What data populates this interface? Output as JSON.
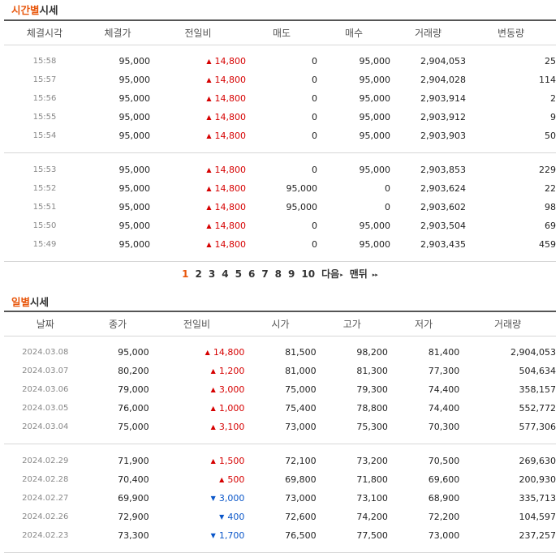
{
  "time_section": {
    "title_hl": "시간별",
    "title_rest": "시세",
    "headers": [
      "체결시각",
      "체결가",
      "전일비",
      "매도",
      "매수",
      "거래량",
      "변동량"
    ],
    "groups": [
      [
        {
          "time": "15:58",
          "price": "95,000",
          "dir": "up",
          "diff": "14,800",
          "sell": "0",
          "buy": "95,000",
          "volume": "2,904,053",
          "change": "25"
        },
        {
          "time": "15:57",
          "price": "95,000",
          "dir": "up",
          "diff": "14,800",
          "sell": "0",
          "buy": "95,000",
          "volume": "2,904,028",
          "change": "114"
        },
        {
          "time": "15:56",
          "price": "95,000",
          "dir": "up",
          "diff": "14,800",
          "sell": "0",
          "buy": "95,000",
          "volume": "2,903,914",
          "change": "2"
        },
        {
          "time": "15:55",
          "price": "95,000",
          "dir": "up",
          "diff": "14,800",
          "sell": "0",
          "buy": "95,000",
          "volume": "2,903,912",
          "change": "9"
        },
        {
          "time": "15:54",
          "price": "95,000",
          "dir": "up",
          "diff": "14,800",
          "sell": "0",
          "buy": "95,000",
          "volume": "2,903,903",
          "change": "50"
        }
      ],
      [
        {
          "time": "15:53",
          "price": "95,000",
          "dir": "up",
          "diff": "14,800",
          "sell": "0",
          "buy": "95,000",
          "volume": "2,903,853",
          "change": "229"
        },
        {
          "time": "15:52",
          "price": "95,000",
          "dir": "up",
          "diff": "14,800",
          "sell": "95,000",
          "buy": "0",
          "volume": "2,903,624",
          "change": "22"
        },
        {
          "time": "15:51",
          "price": "95,000",
          "dir": "up",
          "diff": "14,800",
          "sell": "95,000",
          "buy": "0",
          "volume": "2,903,602",
          "change": "98"
        },
        {
          "time": "15:50",
          "price": "95,000",
          "dir": "up",
          "diff": "14,800",
          "sell": "0",
          "buy": "95,000",
          "volume": "2,903,504",
          "change": "69"
        },
        {
          "time": "15:49",
          "price": "95,000",
          "dir": "up",
          "diff": "14,800",
          "sell": "0",
          "buy": "95,000",
          "volume": "2,903,435",
          "change": "459"
        }
      ]
    ]
  },
  "pagination": {
    "pages": [
      "1",
      "2",
      "3",
      "4",
      "5",
      "6",
      "7",
      "8",
      "9",
      "10"
    ],
    "current": "1",
    "next_label": "다음",
    "next_icon": "▸",
    "last_label": "맨뒤",
    "last_icon": "▸▸"
  },
  "daily_section": {
    "title_hl": "일별",
    "title_rest": "시세",
    "headers": [
      "날짜",
      "종가",
      "전일비",
      "시가",
      "고가",
      "저가",
      "거래량"
    ],
    "groups": [
      [
        {
          "date": "2024.03.08",
          "close": "95,000",
          "dir": "up",
          "diff": "14,800",
          "open": "81,500",
          "high": "98,200",
          "low": "81,400",
          "volume": "2,904,053"
        },
        {
          "date": "2024.03.07",
          "close": "80,200",
          "dir": "up",
          "diff": "1,200",
          "open": "81,000",
          "high": "81,300",
          "low": "77,300",
          "volume": "504,634"
        },
        {
          "date": "2024.03.06",
          "close": "79,000",
          "dir": "up",
          "diff": "3,000",
          "open": "75,000",
          "high": "79,300",
          "low": "74,400",
          "volume": "358,157"
        },
        {
          "date": "2024.03.05",
          "close": "76,000",
          "dir": "up",
          "diff": "1,000",
          "open": "75,400",
          "high": "78,800",
          "low": "74,400",
          "volume": "552,772"
        },
        {
          "date": "2024.03.04",
          "close": "75,000",
          "dir": "up",
          "diff": "3,100",
          "open": "73,000",
          "high": "75,300",
          "low": "70,300",
          "volume": "577,306"
        }
      ],
      [
        {
          "date": "2024.02.29",
          "close": "71,900",
          "dir": "up",
          "diff": "1,500",
          "open": "72,100",
          "high": "73,200",
          "low": "70,500",
          "volume": "269,630"
        },
        {
          "date": "2024.02.28",
          "close": "70,400",
          "dir": "up",
          "diff": "500",
          "open": "69,800",
          "high": "71,800",
          "low": "69,600",
          "volume": "200,930"
        },
        {
          "date": "2024.02.27",
          "close": "69,900",
          "dir": "down",
          "diff": "3,000",
          "open": "73,000",
          "high": "73,100",
          "low": "68,900",
          "volume": "335,713"
        },
        {
          "date": "2024.02.26",
          "close": "72,900",
          "dir": "down",
          "diff": "400",
          "open": "72,600",
          "high": "74,200",
          "low": "72,200",
          "volume": "104,597"
        },
        {
          "date": "2024.02.23",
          "close": "73,300",
          "dir": "down",
          "diff": "1,700",
          "open": "76,500",
          "high": "77,500",
          "low": "73,000",
          "volume": "237,257"
        }
      ]
    ]
  },
  "colors": {
    "accent": "#e8560b",
    "up": "#d60000",
    "down": "#0a56c9"
  },
  "icons": {
    "up": "▲",
    "down": "▼"
  }
}
